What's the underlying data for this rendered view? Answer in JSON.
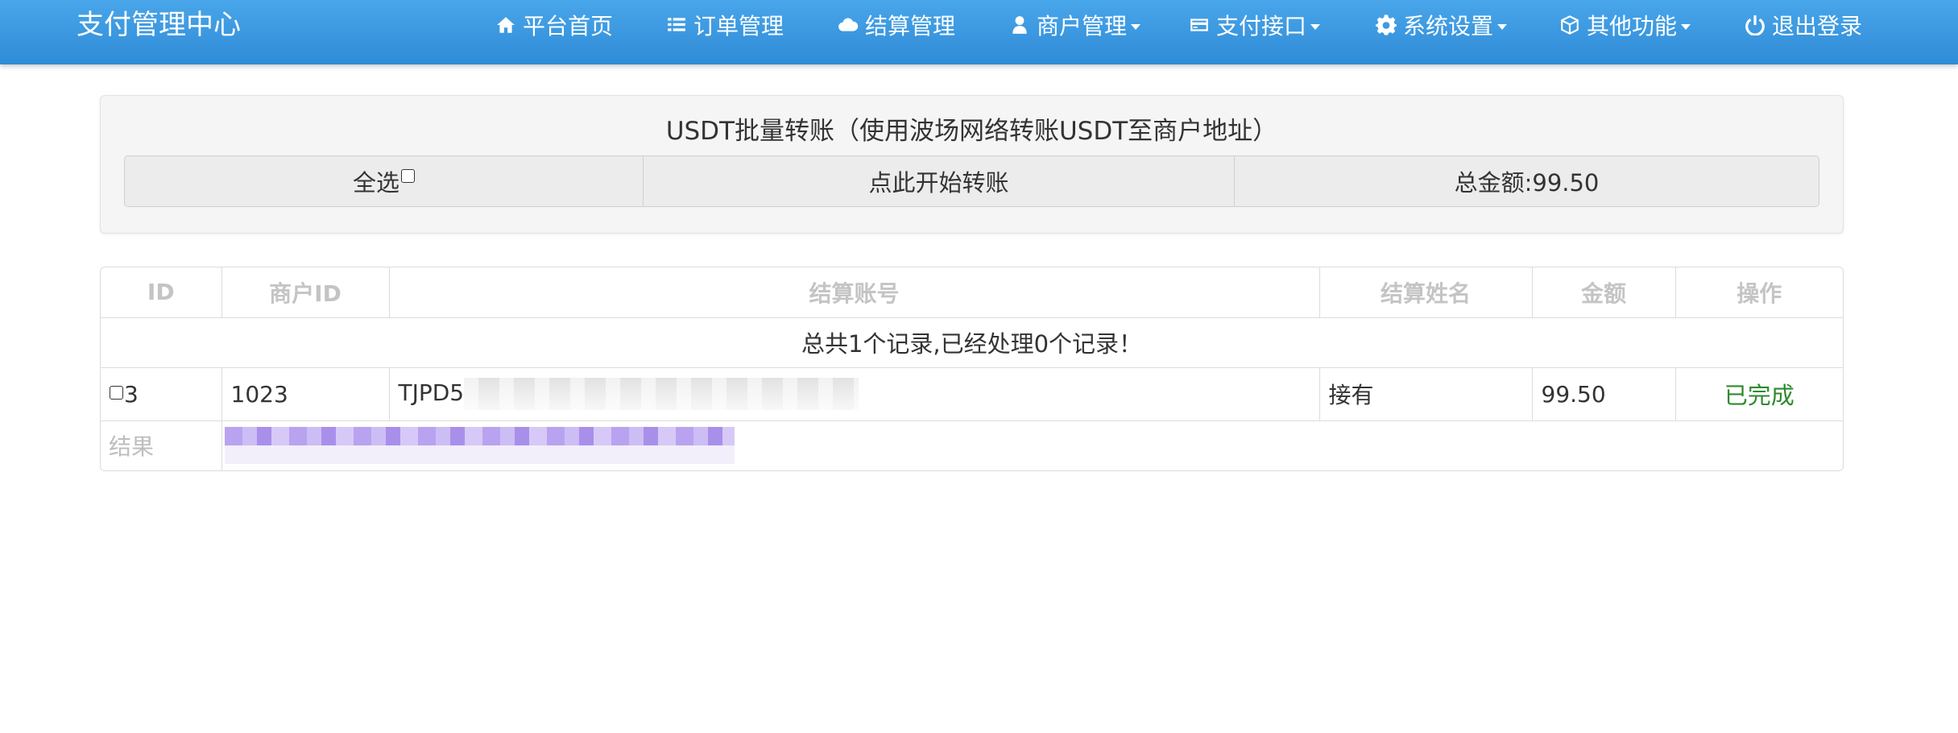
{
  "brand": "支付管理中心",
  "nav": [
    {
      "label": "平台首页",
      "icon": "home-icon",
      "dropdown": false
    },
    {
      "label": "订单管理",
      "icon": "list-icon",
      "dropdown": false
    },
    {
      "label": "结算管理",
      "icon": "cloud-icon",
      "dropdown": false
    },
    {
      "label": "商户管理",
      "icon": "user-icon",
      "dropdown": true
    },
    {
      "label": "支付接口",
      "icon": "credit-card-icon",
      "dropdown": true
    },
    {
      "label": "系统设置",
      "icon": "gear-icon",
      "dropdown": true
    },
    {
      "label": "其他功能",
      "icon": "cube-icon",
      "dropdown": true
    },
    {
      "label": "退出登录",
      "icon": "power-icon",
      "dropdown": false
    }
  ],
  "panel": {
    "title": "USDT批量转账（使用波场网络转账USDT至商户地址）",
    "select_all_label": "全选",
    "start_transfer_label": "点此开始转账",
    "total_label": "总金额:99.50"
  },
  "table": {
    "headers": [
      "ID",
      "商户ID",
      "结算账号",
      "结算姓名",
      "金额",
      "操作"
    ],
    "summary": "总共1个记录,已经处理0个记录！",
    "rows": [
      {
        "id": "3",
        "merchant_id": "1023",
        "account": "TJPD5",
        "name": "接有",
        "amount": "99.50",
        "status": "已完成"
      }
    ],
    "result_label": "结果"
  },
  "colors": {
    "navbar": "#3597e0",
    "status_done": "#2f8a2f",
    "header_text": "#c4c4c4"
  }
}
